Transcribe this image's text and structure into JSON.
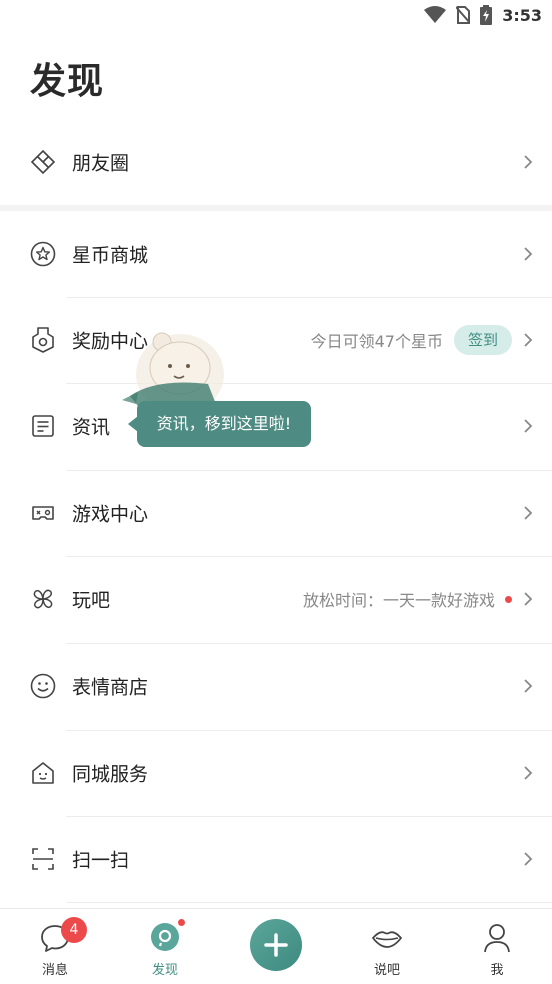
{
  "status": {
    "time": "3:53"
  },
  "page": {
    "title": "发现"
  },
  "menu": {
    "moments": {
      "label": "朋友圈"
    },
    "star_mall": {
      "label": "星币商城"
    },
    "rewards": {
      "label": "奖励中心",
      "hint": "今日可领47个星币",
      "button": "签到"
    },
    "news": {
      "label": "资讯",
      "tooltip": "资讯，移到这里啦!"
    },
    "game_center": {
      "label": "游戏中心"
    },
    "play": {
      "label": "玩吧",
      "hint": "放松时间：一天一款好游戏"
    },
    "stickers": {
      "label": "表情商店"
    },
    "local_service": {
      "label": "同城服务"
    },
    "scan": {
      "label": "扫一扫"
    }
  },
  "tabs": {
    "messages": {
      "label": "消息",
      "badge": "4"
    },
    "discover": {
      "label": "发现"
    },
    "talk": {
      "label": "说吧"
    },
    "me": {
      "label": "我"
    }
  },
  "colors": {
    "accent": "#3e8f83",
    "badge": "#ec4a4a",
    "tooltip": "#4e8b82"
  }
}
